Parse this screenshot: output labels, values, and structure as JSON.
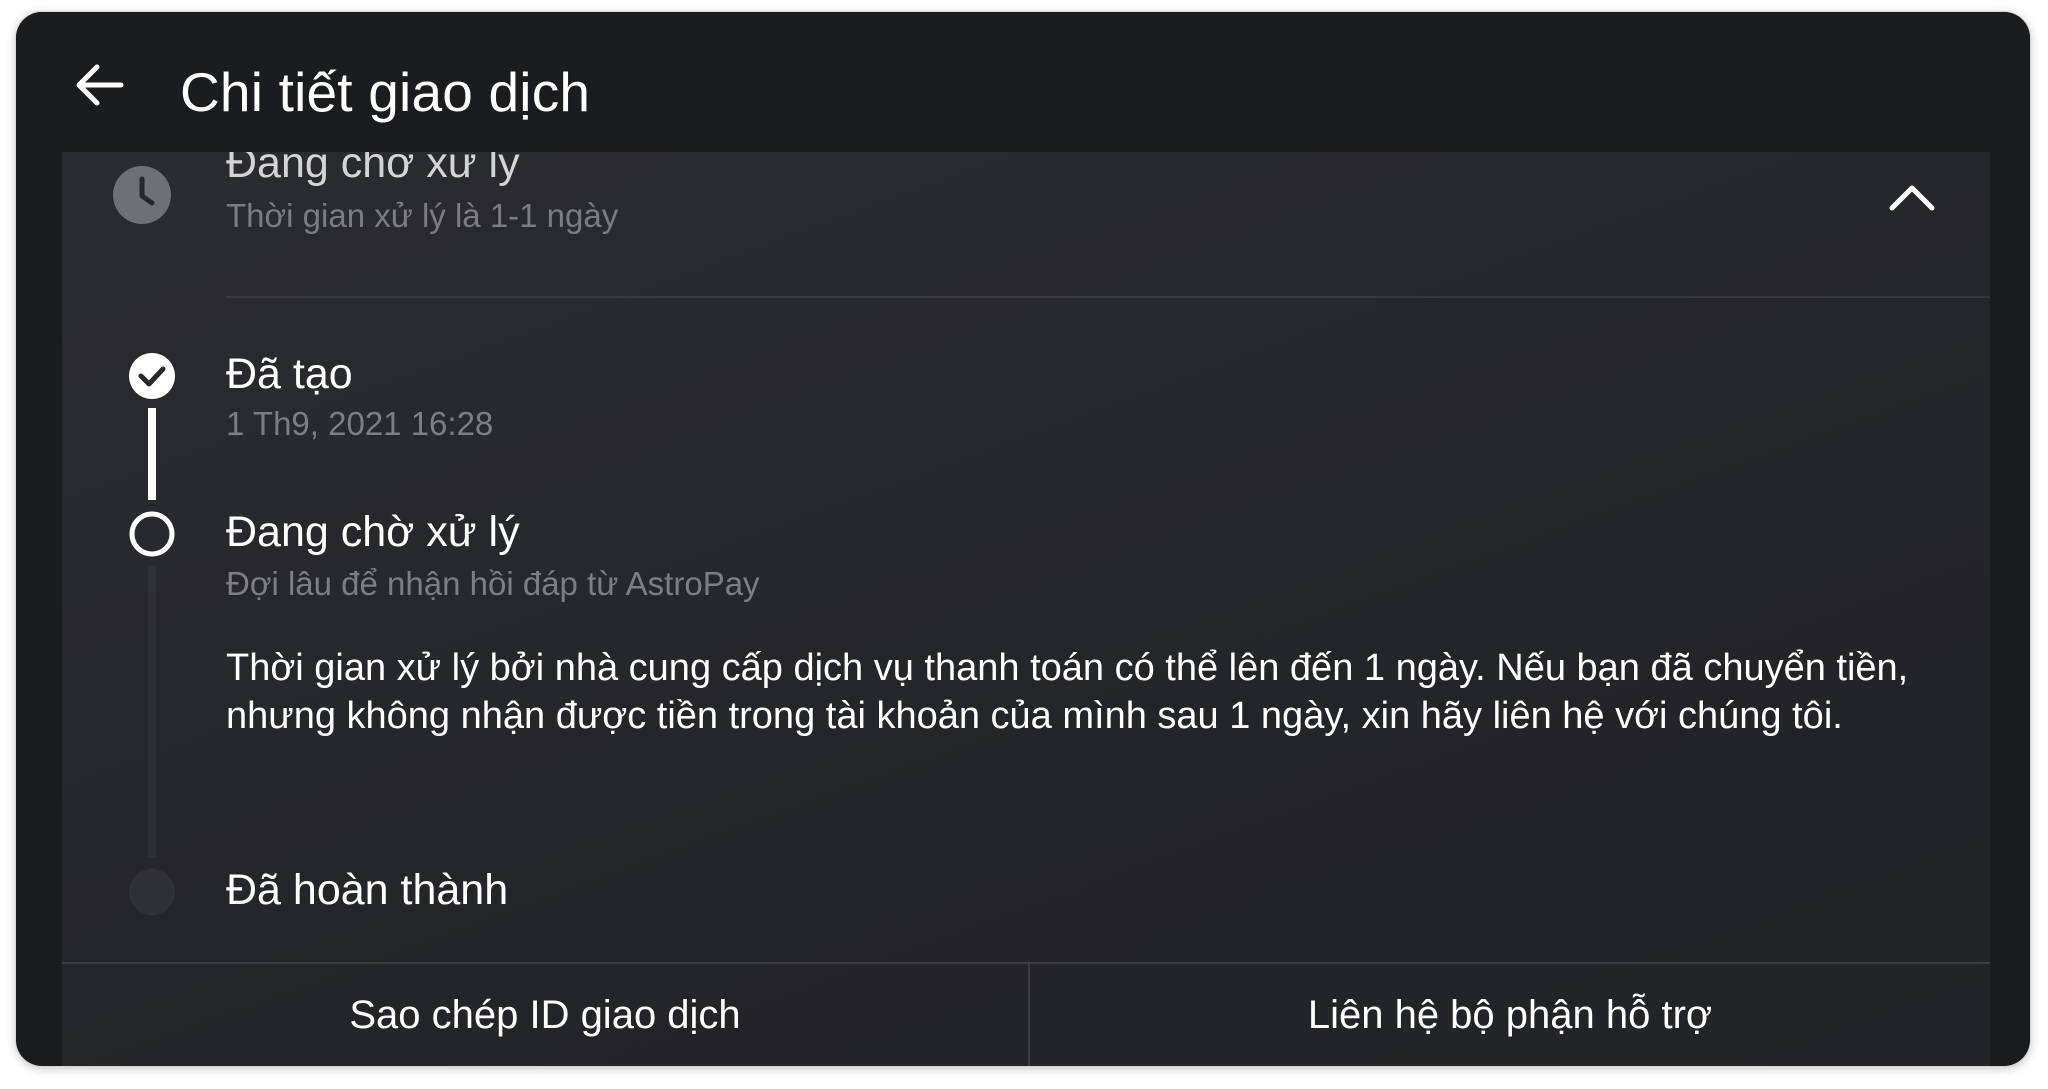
{
  "header": {
    "title": "Chi tiết giao dịch",
    "back_icon": "arrow-left-icon"
  },
  "summary": {
    "status": "Đang chờ xử lý",
    "processing_time": "Thời gian xử lý là 1-1 ngày",
    "status_icon": "clock-icon",
    "toggle_icon": "chevron-up-icon"
  },
  "timeline": [
    {
      "title": "Đã tạo",
      "timestamp": "1 Th9, 2021 16:28",
      "state": "completed",
      "icon": "check-circle-icon"
    },
    {
      "title": "Đang chờ xử lý",
      "subtitle": "Đợi lâu để nhận hồi đáp từ AstroPay",
      "description": "Thời gian xử lý bởi nhà cung cấp dịch vụ thanh toán có thể lên đến 1 ngày. Nếu bạn đã chuyển tiền, nhưng không nhận được tiền trong tài khoản của mình sau 1 ngày, xin hãy liên hệ với chúng tôi.",
      "state": "current",
      "icon": "empty-circle-icon"
    },
    {
      "title": "Đã hoàn thành",
      "state": "pending",
      "icon": "dot-icon"
    }
  ],
  "actions": {
    "copy_id": "Sao chép ID giao dịch",
    "contact_support": "Liên hệ bộ phận hỗ trợ"
  },
  "colors": {
    "background": "#1b1c1e",
    "card": "#27282b",
    "text_primary": "#ffffff",
    "text_secondary": "#7d7e82",
    "icon_muted": "#6f7074"
  }
}
